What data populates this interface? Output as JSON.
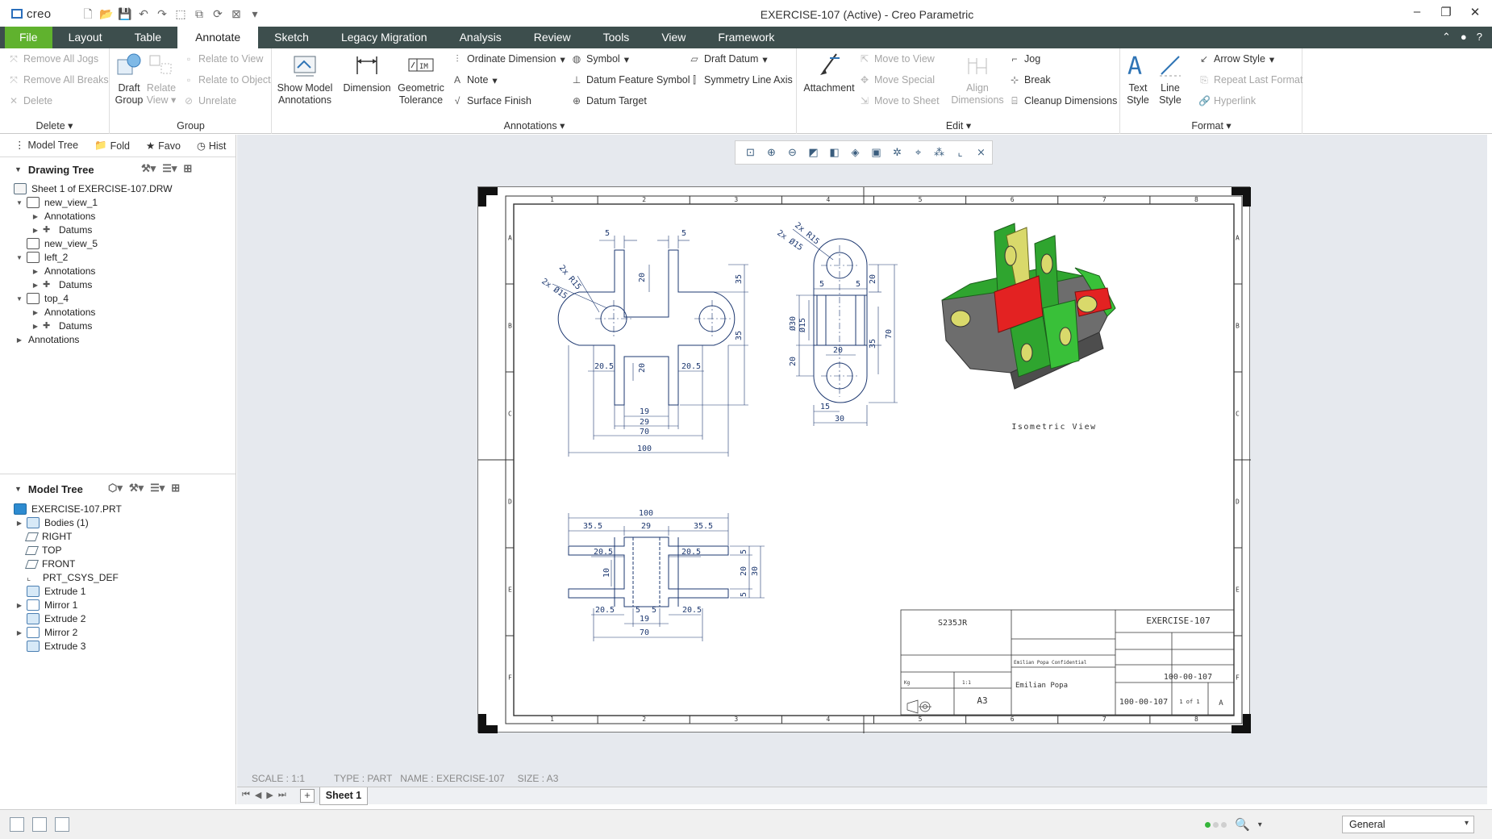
{
  "window": {
    "app_name": "creo",
    "title": "EXERCISE-107 (Active) - Creo Parametric",
    "controls": [
      "–",
      "❐",
      "✕"
    ]
  },
  "menu": {
    "tabs": [
      "File",
      "Layout",
      "Table",
      "Annotate",
      "Sketch",
      "Legacy Migration",
      "Analysis",
      "Review",
      "Tools",
      "View",
      "Framework"
    ],
    "active": "Annotate"
  },
  "ribbon": {
    "delete": {
      "label": "Delete",
      "remove_jogs": "Remove All Jogs",
      "remove_breaks": "Remove All Breaks",
      "delete": "Delete"
    },
    "group": {
      "label": "Group",
      "draft_group": "Draft\nGroup",
      "relate_view": "Relate\nView",
      "relate_to_view": "Relate to View",
      "relate_to_object": "Relate to Object",
      "unrelate": "Unrelate"
    },
    "annotations": {
      "label": "Annotations",
      "show_model": "Show Model\nAnnotations",
      "dimension": "Dimension",
      "geom_tol": "Geometric\nTolerance",
      "ordinate": "Ordinate Dimension",
      "note": "Note",
      "surface_finish": "Surface Finish",
      "symbol": "Symbol",
      "datum_feature": "Datum Feature Symbol",
      "datum_target": "Datum Target",
      "draft_datum": "Draft Datum",
      "symmetry": "Symmetry Line Axis"
    },
    "edit": {
      "label": "Edit",
      "attachment": "Attachment",
      "move_to_view": "Move to View",
      "move_special": "Move Special",
      "move_to_sheet": "Move to Sheet",
      "align_dims": "Align\nDimensions",
      "jog": "Jog",
      "break": "Break",
      "cleanup": "Cleanup Dimensions"
    },
    "format": {
      "label": "Format",
      "text_style": "Text\nStyle",
      "line_style": "Line\nStyle",
      "arrow_style": "Arrow Style",
      "repeat_last": "Repeat Last Format",
      "hyperlink": "Hyperlink"
    }
  },
  "left_panel": {
    "tabs": [
      "Model Tree",
      "Fold",
      "Favo",
      "Hist"
    ],
    "drawing_tree": {
      "header": "Drawing Tree",
      "items": [
        "Sheet 1 of EXERCISE-107.DRW",
        "new_view_1",
        "Annotations",
        "Datums",
        "new_view_5",
        "left_2",
        "Annotations",
        "Datums",
        "top_4",
        "Annotations",
        "Datums",
        "Annotations"
      ]
    },
    "model_tree": {
      "header": "Model Tree",
      "items": [
        "EXERCISE-107.PRT",
        "Bodies (1)",
        "RIGHT",
        "TOP",
        "FRONT",
        "PRT_CSYS_DEF",
        "Extrude 1",
        "Mirror 1",
        "Extrude 2",
        "Mirror 2",
        "Extrude 3"
      ]
    }
  },
  "drawing": {
    "zone_numbers": [
      "1",
      "2",
      "3",
      "4",
      "5",
      "6",
      "7",
      "8"
    ],
    "zone_letters": [
      "A",
      "B",
      "C",
      "D",
      "E",
      "F"
    ],
    "isometric_label": "Isometric View",
    "front_dims": [
      "5",
      "5",
      "20",
      "35",
      "35",
      "20",
      "20.5",
      "20.5",
      "19",
      "29",
      "70",
      "100",
      "2x R15",
      "2x Ø15"
    ],
    "side_dims": [
      "2x R15",
      "2x Ø15",
      "20",
      "5",
      "5",
      "Ø30",
      "Ø15",
      "20",
      "35",
      "70",
      "20",
      "15",
      "30"
    ],
    "top_dims": [
      "100",
      "35.5",
      "29",
      "35.5",
      "20.5",
      "20.5",
      "10",
      "5",
      "20",
      "30",
      "5",
      "20.5",
      "5",
      "5",
      "20.5",
      "19",
      "70"
    ],
    "title_block": {
      "material": "S235JR",
      "description": "EXERCISE-107",
      "part_number": "100-00-107",
      "drawing_number": "100-00-107",
      "sheet": "1 of 1",
      "revision": "A",
      "size": "A3",
      "author": "Emilian Popa",
      "confidential": "Emilian Popa Confidential",
      "weight": "Kg",
      "scale": "1:1"
    }
  },
  "status": {
    "scale": "SCALE : 1:1",
    "type": "TYPE : PART",
    "name": "NAME : EXERCISE-107",
    "size": "SIZE : A3"
  },
  "sheet_tab": "Sheet 1",
  "bottom": {
    "filter": "General"
  }
}
